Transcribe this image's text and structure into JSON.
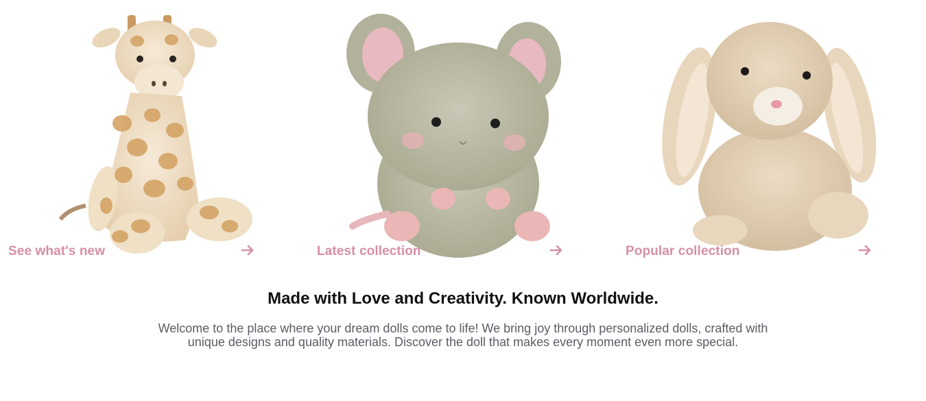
{
  "cards": [
    {
      "label": "See what's new",
      "icon": "arrow-right-icon",
      "image": "giraffe-plush"
    },
    {
      "label": "Latest collection",
      "icon": "arrow-right-icon",
      "image": "mouse-plush"
    },
    {
      "label": "Popular collection",
      "icon": "arrow-right-icon",
      "image": "bunny-plush"
    }
  ],
  "intro": {
    "heading": "Made with Love and Creativity. Known Worldwide.",
    "description": "Welcome to the place where your dream dolls come to life! We bring joy through personalized dolls, crafted with unique designs and quality materials. Discover the doll that makes every moment even more special."
  },
  "colors": {
    "accent": "#d68fa6",
    "heading": "#111111",
    "body_text": "#5b5b66"
  }
}
